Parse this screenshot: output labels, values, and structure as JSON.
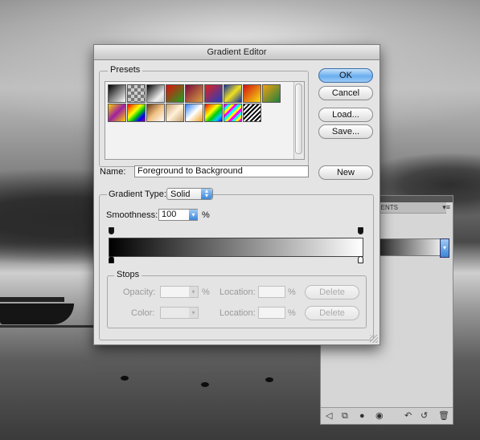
{
  "dialog": {
    "title": "Gradient Editor",
    "presets_label": "Presets",
    "name_label": "Name:",
    "name_value": "Foreground to Background",
    "gradient_type_label": "Gradient Type:",
    "gradient_type_value": "Solid",
    "smoothness_label": "Smoothness:",
    "smoothness_value": "100",
    "smoothness_unit": "%",
    "stops": {
      "label": "Stops",
      "opacity_label": "Opacity:",
      "opacity_unit": "%",
      "color_label": "Color:",
      "location_label": "Location:",
      "location_unit": "%",
      "delete_label": "Delete"
    },
    "buttons": {
      "ok": "OK",
      "cancel": "Cancel",
      "load": "Load...",
      "save": "Save...",
      "new": "New"
    },
    "gradient_colors": {
      "start": "#000000",
      "end": "#ffffff"
    }
  },
  "side_panel": {
    "tab_label": "MENTS"
  },
  "icons": [
    "menu-arrow-icon",
    "dropdown-arrow-icon",
    "color-stop-icon",
    "opacity-stop-icon",
    "resize-grip-icon"
  ]
}
